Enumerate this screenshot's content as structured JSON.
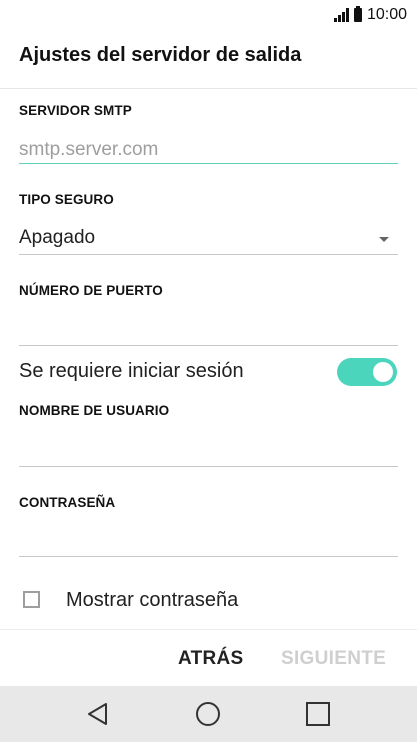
{
  "status_bar": {
    "time": "10:00"
  },
  "header": {
    "title": "Ajustes del servidor de salida"
  },
  "form": {
    "smtp_server": {
      "label": "SERVIDOR SMTP",
      "value": "",
      "placeholder": "smtp.server.com"
    },
    "security_type": {
      "label": "TIPO SEGURO",
      "selected": "Apagado"
    },
    "port_number": {
      "label": "NÚMERO DE PUERTO",
      "value": ""
    },
    "login_required": {
      "label": "Se requiere iniciar sesión",
      "enabled": true
    },
    "username": {
      "label": "NOMBRE DE USUARIO",
      "value": ""
    },
    "password": {
      "label": "CONTRASEÑA",
      "value": ""
    },
    "show_password": {
      "label": "Mostrar contraseña",
      "checked": false
    }
  },
  "footer": {
    "back_label": "ATRÁS",
    "next_label": "SIGUIENTE"
  },
  "colors": {
    "accent": "#4cd5bd",
    "disabled": "#cfcfcf",
    "nav_bar": "#e8e8e8"
  },
  "icons": [
    "signal-icon",
    "battery-icon",
    "dropdown-arrow-icon",
    "nav-back-icon",
    "nav-home-icon",
    "nav-recent-icon"
  ]
}
